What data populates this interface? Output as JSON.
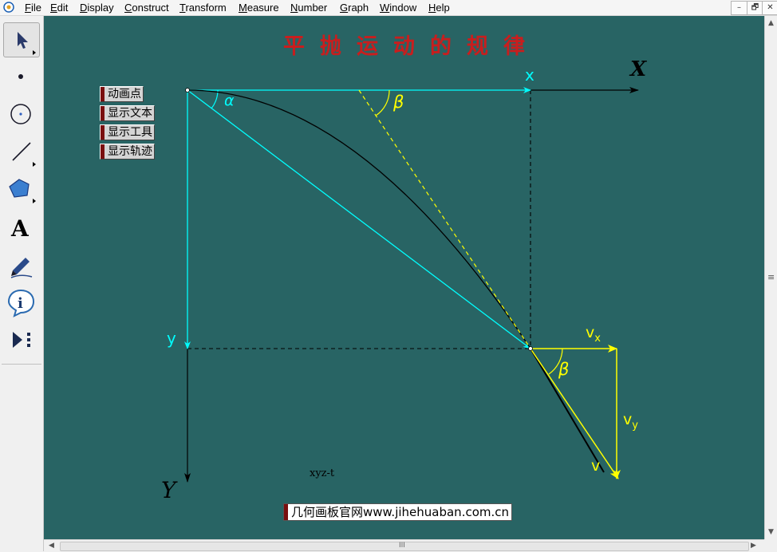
{
  "menu": {
    "items": [
      {
        "pre": "",
        "u": "F",
        "post": "ile"
      },
      {
        "pre": "",
        "u": "E",
        "post": "dit"
      },
      {
        "pre": "",
        "u": "D",
        "post": "isplay"
      },
      {
        "pre": "",
        "u": "C",
        "post": "onstruct"
      },
      {
        "pre": "",
        "u": "T",
        "post": "ransform"
      },
      {
        "pre": "",
        "u": "M",
        "post": "easure"
      },
      {
        "pre": "",
        "u": "N",
        "post": "umber"
      },
      {
        "pre": "",
        "u": "G",
        "post": "raph"
      },
      {
        "pre": "",
        "u": "W",
        "post": "indow"
      },
      {
        "pre": "",
        "u": "H",
        "post": "elp"
      }
    ]
  },
  "window_controls": {
    "minimize": "–",
    "restore": "🗗",
    "close": "✕"
  },
  "tools": [
    "arrow-tool",
    "point-tool",
    "compass-tool",
    "straightedge-tool",
    "polygon-tool",
    "text-tool",
    "marker-tool",
    "information-tool",
    "custom-tool"
  ],
  "sketch": {
    "title": "平抛运动的规律",
    "buttons": {
      "animate": "动画点",
      "show_text": "显示文本",
      "show_tools": "显示工具",
      "show_trace": "显示轨迹"
    },
    "labels": {
      "x_small": "x",
      "X_axis": "X",
      "y_small": "y",
      "Y_axis": "Y",
      "alpha": "α",
      "beta_top": "β",
      "beta_bottom": "β",
      "vx": "v",
      "vx_sub": "x",
      "vy": "v",
      "vy_sub": "y",
      "v": "v"
    },
    "caption": "xyz-t",
    "link": "几何画板官网www.jihehuaban.com.cn"
  },
  "colors": {
    "canvas_bg": "#286464",
    "cyan": "#00ffff",
    "yellow": "#ffff00",
    "title_red": "#c81e1e",
    "axis_black": "#000000"
  },
  "scrollbars": {
    "h_grip": "III",
    "v_grip": "≡"
  }
}
